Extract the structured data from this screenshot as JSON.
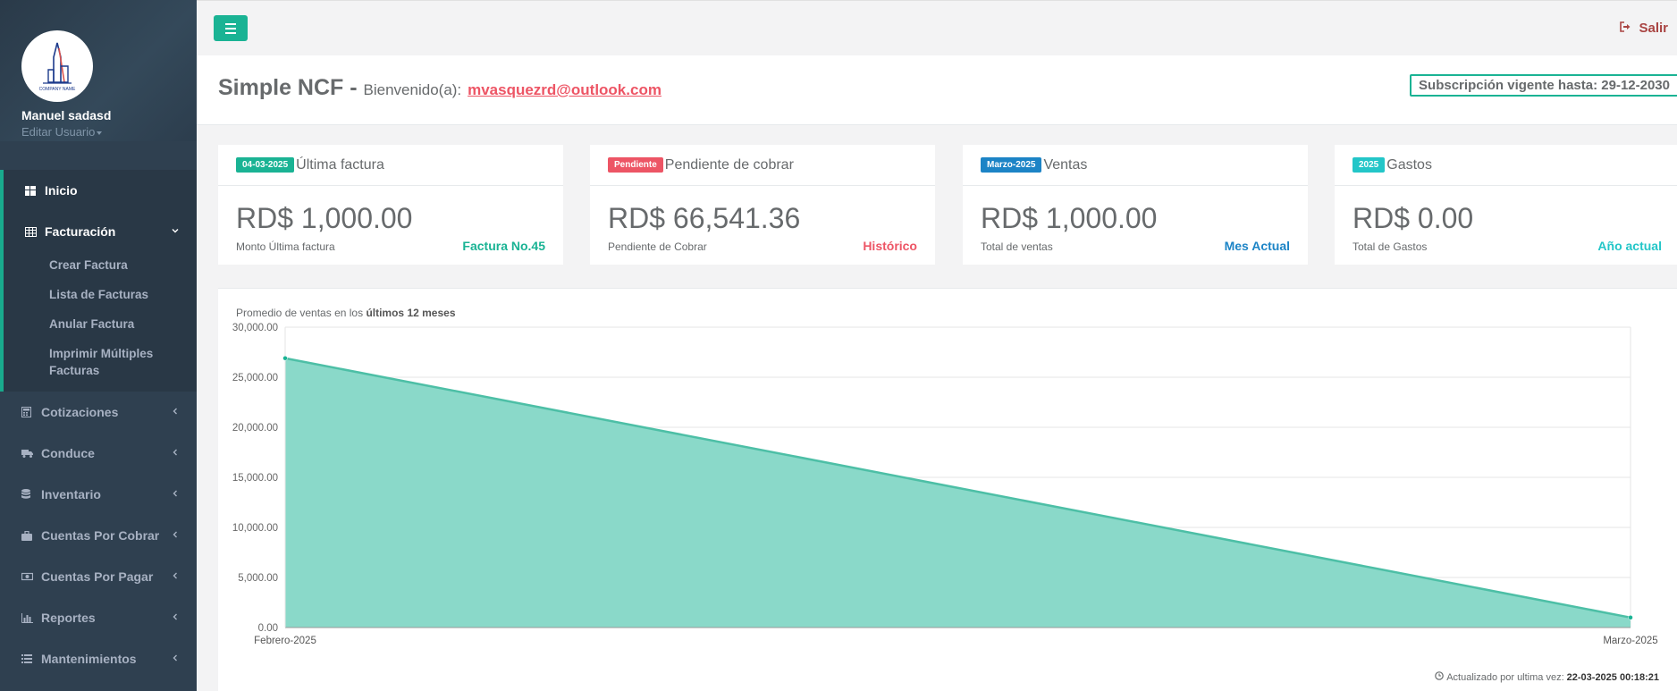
{
  "sidebar": {
    "user_name": "Manuel sadasd",
    "edit_user": "Editar Usuario",
    "logo_text": "COMPANY NAME",
    "active_section": {
      "label": "Facturación",
      "subitems": [
        "Crear Factura",
        "Lista de Facturas",
        "Anular Factura",
        "Imprimir Múltiples",
        "Facturas"
      ]
    },
    "items": [
      {
        "label": "Inicio",
        "icon": "dashboard-icon"
      },
      {
        "label": "Facturación",
        "icon": "table-icon"
      },
      {
        "label": "Cotizaciones",
        "icon": "calculator-icon"
      },
      {
        "label": "Conduce",
        "icon": "truck-icon"
      },
      {
        "label": "Inventario",
        "icon": "database-icon"
      },
      {
        "label": "Cuentas Por Cobrar",
        "icon": "briefcase-icon"
      },
      {
        "label": "Cuentas Por Pagar",
        "icon": "money-icon"
      },
      {
        "label": "Reportes",
        "icon": "bar-chart-icon"
      },
      {
        "label": "Mantenimientos",
        "icon": "list-icon"
      }
    ]
  },
  "topbar": {
    "logout_label": "Salir"
  },
  "header": {
    "title": "Simple NCF -",
    "welcome": "Bienvenido(a):",
    "email": "mvasquezrd@outlook.com",
    "subscription": "Subscripción vigente hasta: 29-12-2030"
  },
  "cards": [
    {
      "badge": "04-03-2025",
      "badge_color": "#1ab394",
      "title": "Última factura",
      "value": "RD$ 1,000.00",
      "sub": "Monto Última factura",
      "link": "Factura No.45",
      "link_color": "#1ab394"
    },
    {
      "badge": "Pendiente",
      "badge_color": "#ed5565",
      "title": "Pendiente de cobrar",
      "value": "RD$ 66,541.36",
      "sub": "Pendiente de Cobrar",
      "link": "Histórico",
      "link_color": "#ed5565"
    },
    {
      "badge": "Marzo-2025",
      "badge_color": "#1c84c6",
      "title": "Ventas",
      "value": "RD$ 1,000.00",
      "sub": "Total de ventas",
      "link": "Mes Actual",
      "link_color": "#1c84c6"
    },
    {
      "badge": "2025",
      "badge_color": "#23c6c8",
      "title": "Gastos",
      "value": "RD$ 0.00",
      "sub": "Total de Gastos",
      "link": "Año actual",
      "link_color": "#23c6c8"
    }
  ],
  "chart_caption": {
    "prefix": "Promedio de ventas en los",
    "bold": "últimos 12 meses"
  },
  "updated": {
    "label": "Actualizado por ultima vez:",
    "value": "22-03-2025 00:18:21"
  },
  "chart_data": {
    "type": "area",
    "categories": [
      "Febrero-2025",
      "Marzo-2025"
    ],
    "values": [
      26900,
      1000
    ],
    "ylim": [
      0,
      30000
    ],
    "yticks": [
      "0.00",
      "5,000.00",
      "10,000.00",
      "15,000.00",
      "20,000.00",
      "25,000.00",
      "30,000.00"
    ],
    "fill_color": "#8ad9c9",
    "line_color": "#4dbfa6",
    "grid": true
  }
}
